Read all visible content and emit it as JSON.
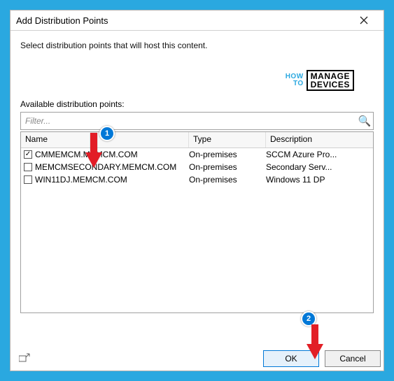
{
  "windowTitle": "Add Distribution Points",
  "instruction": "Select distribution points that will host this content.",
  "watermark": {
    "how1": "HOW",
    "how2": "TO",
    "box1": "MANAGE",
    "box2": "DEVICES"
  },
  "listLabel": "Available distribution points:",
  "filterPlaceholder": "Filter...",
  "columns": {
    "name": "Name",
    "type": "Type",
    "desc": "Description"
  },
  "rows": [
    {
      "checked": true,
      "name": "CMMEMCM.MEMCM.COM",
      "type": "On-premises",
      "desc": "SCCM Azure Pro..."
    },
    {
      "checked": false,
      "name": "MEMCMSECONDARY.MEMCM.COM",
      "type": "On-premises",
      "desc": "Secondary Serv..."
    },
    {
      "checked": false,
      "name": "WIN11DJ.MEMCM.COM",
      "type": "On-premises",
      "desc": "Windows 11 DP"
    }
  ],
  "buttons": {
    "ok": "OK",
    "cancel": "Cancel"
  },
  "annotations": {
    "badge1": "1",
    "badge2": "2"
  }
}
